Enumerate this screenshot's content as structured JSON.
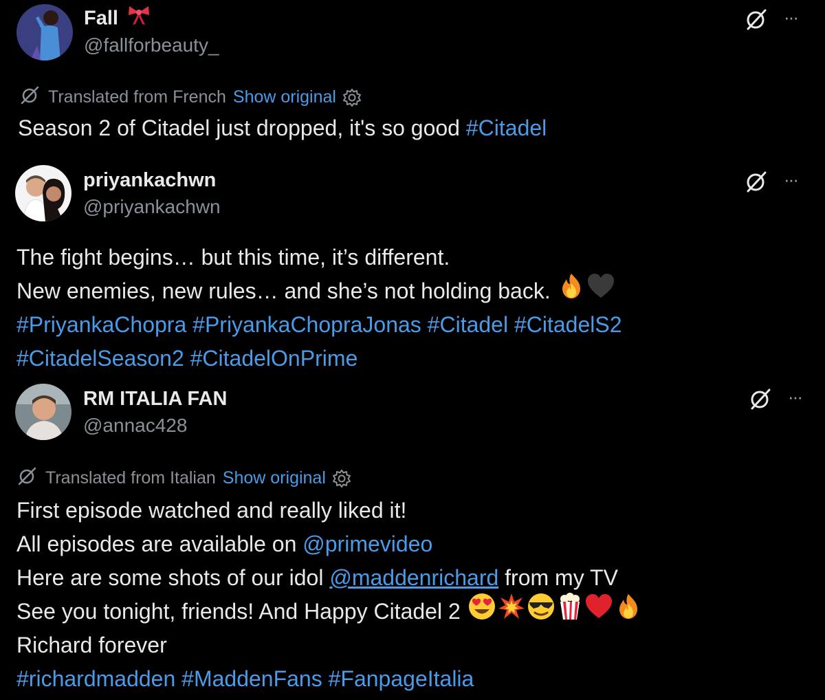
{
  "colors": {
    "background": "#000000",
    "text": "#e7e9ea",
    "muted": "#8b9198",
    "link": "#4a9be8"
  },
  "icons": {
    "grok": "slashed-circle-icon",
    "more": "more-horizontal-icon",
    "translate": "translate-icon",
    "settings": "gear-icon"
  },
  "posts": [
    {
      "display_name": "Fall",
      "badge_emoji": "🎀",
      "handle": "@fallforbeauty_",
      "more_label": "···",
      "translation": {
        "label": "Translated from French",
        "show_original": "Show original"
      },
      "lines": [
        {
          "text": "Season 2 of Citadel just dropped, it's so good ",
          "tag": "#Citadel"
        }
      ]
    },
    {
      "display_name": "priyankachwn",
      "handle": "@priyankachwn",
      "more_label": "···",
      "lines": [
        {
          "text": "The fight begins… but this time, it’s different."
        },
        {
          "text": "New enemies, new rules… and she’s not holding back. ",
          "emojis": [
            "🔥",
            "🖤"
          ]
        },
        {
          "tags": "#PriyankaChopra #PriyankaChopraJonas #Citadel #CitadelS2"
        },
        {
          "tags": "#CitadelSeason2 #CitadelOnPrime"
        }
      ]
    },
    {
      "display_name": "RM ITALIA FAN",
      "handle": "@annac428",
      "more_label": "···",
      "translation": {
        "label": "Translated from Italian",
        "show_original": "Show original"
      },
      "lines": [
        {
          "text": "First episode watched and really liked it!"
        },
        {
          "text": "All episodes are available on ",
          "mention": "@primevideo"
        },
        {
          "text": "Here are some shots of our idol ",
          "mention": "@maddenrichard",
          "after": " from my TV"
        },
        {
          "text": "See you tonight, friends! And Happy Citadel 2 ",
          "emojis": [
            "😍",
            "💥",
            "😎",
            "🍿",
            "❤️",
            "🔥"
          ]
        },
        {
          "text": "Richard forever"
        },
        {
          "tags": "#richardmadden #MaddenFans #FanpageItalia"
        }
      ]
    }
  ]
}
